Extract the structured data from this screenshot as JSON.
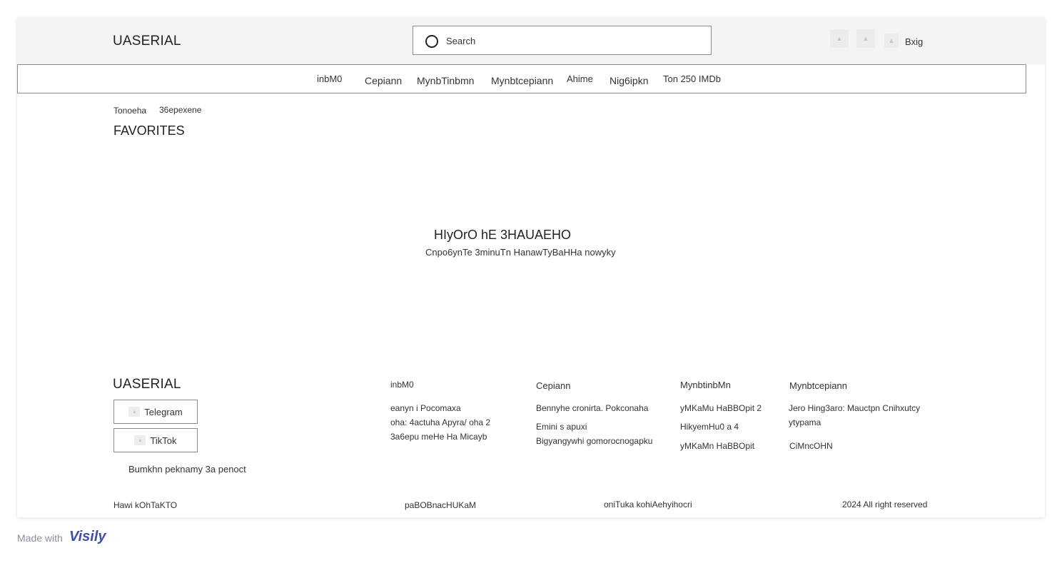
{
  "header": {
    "logo": "UASERIAL",
    "search_placeholder": "Search",
    "login_label": "Bxig"
  },
  "nav": {
    "items": [
      "inbM0",
      "Cepiann",
      "MynbTinbmn",
      "Mynbtcepiann",
      "Ahime",
      "Nig6ipkn",
      "Ton 250 IMDb"
    ]
  },
  "breadcrumb": [
    "Tonoeha",
    "36epexene"
  ],
  "page": {
    "title": "FAVORITES",
    "empty_title": "HIyOrO hE 3HAUAEHO",
    "empty_subtitle": "Cnpo6ynTe 3minuTn HanawTyBaHHa nowyky"
  },
  "footer": {
    "logo": "UASERIAL",
    "social": [
      "Telegram",
      "TikTok"
    ],
    "ad_link": "Bumkhn peknamy 3a penoct",
    "columns": [
      {
        "title": "inbM0",
        "links": [
          "eanyn i Pocomaxa",
          "oha: 4actuha Apyra/ oha 2",
          "3a6epu meHe Ha Micayb"
        ]
      },
      {
        "title": "Cepiann",
        "links": [
          "Bennyhe cronirta. Pokconaha",
          "Emini s apuxi",
          "Bigyangywhi gomorocnogapku"
        ]
      },
      {
        "title": "MynbtinbMn",
        "links": [
          "yMKaMu HaBBOpit 2",
          "HikyemHu0 a 4",
          "yMKaMn HaBBOpit"
        ]
      },
      {
        "title": "Mynbtcepiann",
        "links": [
          "Jero Hing3aro: Mauctpn Cnihxutcy",
          "ytypama",
          "CiMncOHN"
        ]
      }
    ],
    "bottom": [
      "Hawi kOhTaKTO",
      "paBOBnacHUKaM",
      "oniTuka kohiAehyihocri",
      "2024 All right reserved"
    ]
  },
  "watermark": {
    "text": "Made with",
    "brand": "Visily"
  },
  "colors": {
    "header_bg": "#f4f4f6",
    "border": "#8c8c8c",
    "brand": "#3d4fa8"
  }
}
